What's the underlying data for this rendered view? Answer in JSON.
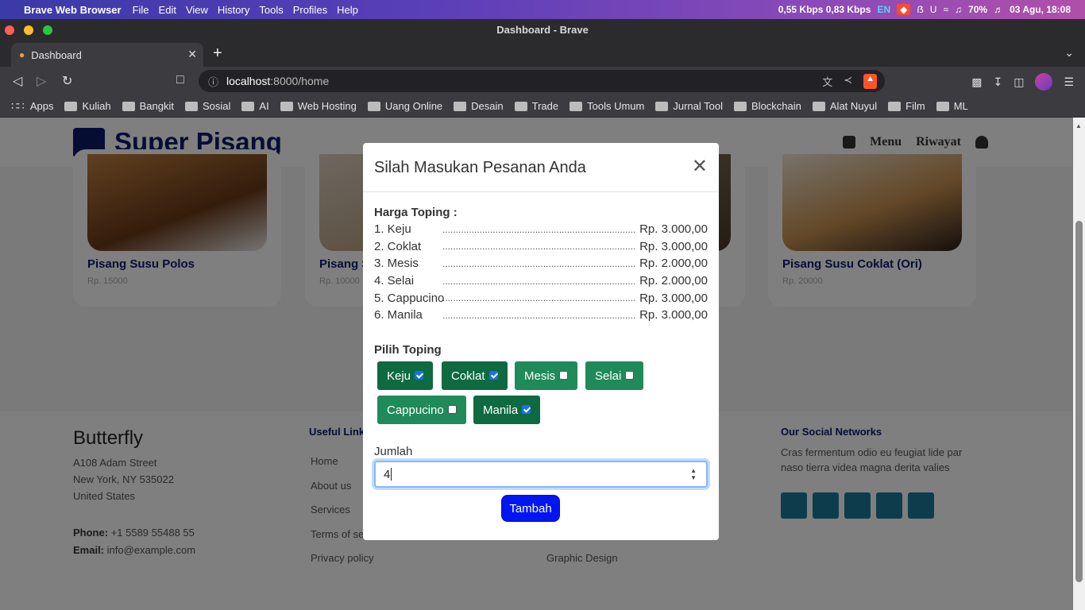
{
  "menubar": {
    "app_name": "Brave Web Browser",
    "items": [
      "File",
      "Edit",
      "View",
      "History",
      "Tools",
      "Profiles",
      "Help"
    ],
    "net_speed": "0,55 Kbps 0,83 Kbps",
    "lang": "EN",
    "battery": "70%",
    "datetime": "03 Agu, 18:08"
  },
  "browser": {
    "window_title": "Dashboard - Brave",
    "tab_title": "Dashboard",
    "url_host": "localhost",
    "url_rest": ":8000/home",
    "bookmarks": [
      "Apps",
      "Kuliah",
      "Bangkit",
      "Sosial",
      "AI",
      "Web Hosting",
      "Uang Online",
      "Desain",
      "Trade",
      "Tools Umum",
      "Jurnal Tool",
      "Blockchain",
      "Alat Nuyul",
      "Film",
      "ML"
    ]
  },
  "site": {
    "brand": "Super Pisang",
    "nav": {
      "menu": "Menu",
      "riwayat": "Riwayat"
    },
    "cards": [
      {
        "title": "Pisang Susu Polos",
        "price": "Rp. 15000"
      },
      {
        "title": "Pisang S",
        "price": "Rp. 10000"
      },
      {
        "title": "Pisang Susu Coklat (Ori)",
        "price": "Rp. 20000"
      }
    ],
    "footer": {
      "brand": "Butterfly",
      "address": [
        "A108 Adam Street",
        "New York, NY 535022",
        "United States"
      ],
      "phone_label": "Phone:",
      "phone": "+1 5589 55488 55",
      "email_label": "Email:",
      "email": "info@example.com",
      "useful_links_title": "Useful Links",
      "useful_links": [
        "Home",
        "About us",
        "Services",
        "Terms of se",
        "Privacy policy"
      ],
      "services_last": "Graphic Design",
      "social_title": "Our Social Networks",
      "social_text": "Cras fermentum odio eu feugiat lide par naso tierra videa magna derita valies"
    }
  },
  "modal": {
    "title": "Silah Masukan Pesanan Anda",
    "harga_title": "Harga Toping :",
    "harga": [
      {
        "name": "1. Keju",
        "price": "Rp. 3.000,00"
      },
      {
        "name": "2. Coklat",
        "price": "Rp. 3.000,00"
      },
      {
        "name": "3. Mesis",
        "price": "Rp. 2.000,00"
      },
      {
        "name": "4. Selai",
        "price": "Rp. 2.000,00"
      },
      {
        "name": "5. Cappucino",
        "price": "Rp. 3.000,00"
      },
      {
        "name": "6. Manila",
        "price": "Rp. 3.000,00"
      }
    ],
    "dots": "...................................................................................",
    "pilih_title": "Pilih Toping",
    "toppings": [
      {
        "label": "Keju",
        "checked": true
      },
      {
        "label": "Coklat",
        "checked": true
      },
      {
        "label": "Mesis",
        "checked": false
      },
      {
        "label": "Selai",
        "checked": false
      },
      {
        "label": "Cappucino",
        "checked": false
      },
      {
        "label": "Manila",
        "checked": true
      }
    ],
    "jumlah_label": "Jumlah",
    "jumlah_value": "4",
    "submit": "Tambah"
  }
}
